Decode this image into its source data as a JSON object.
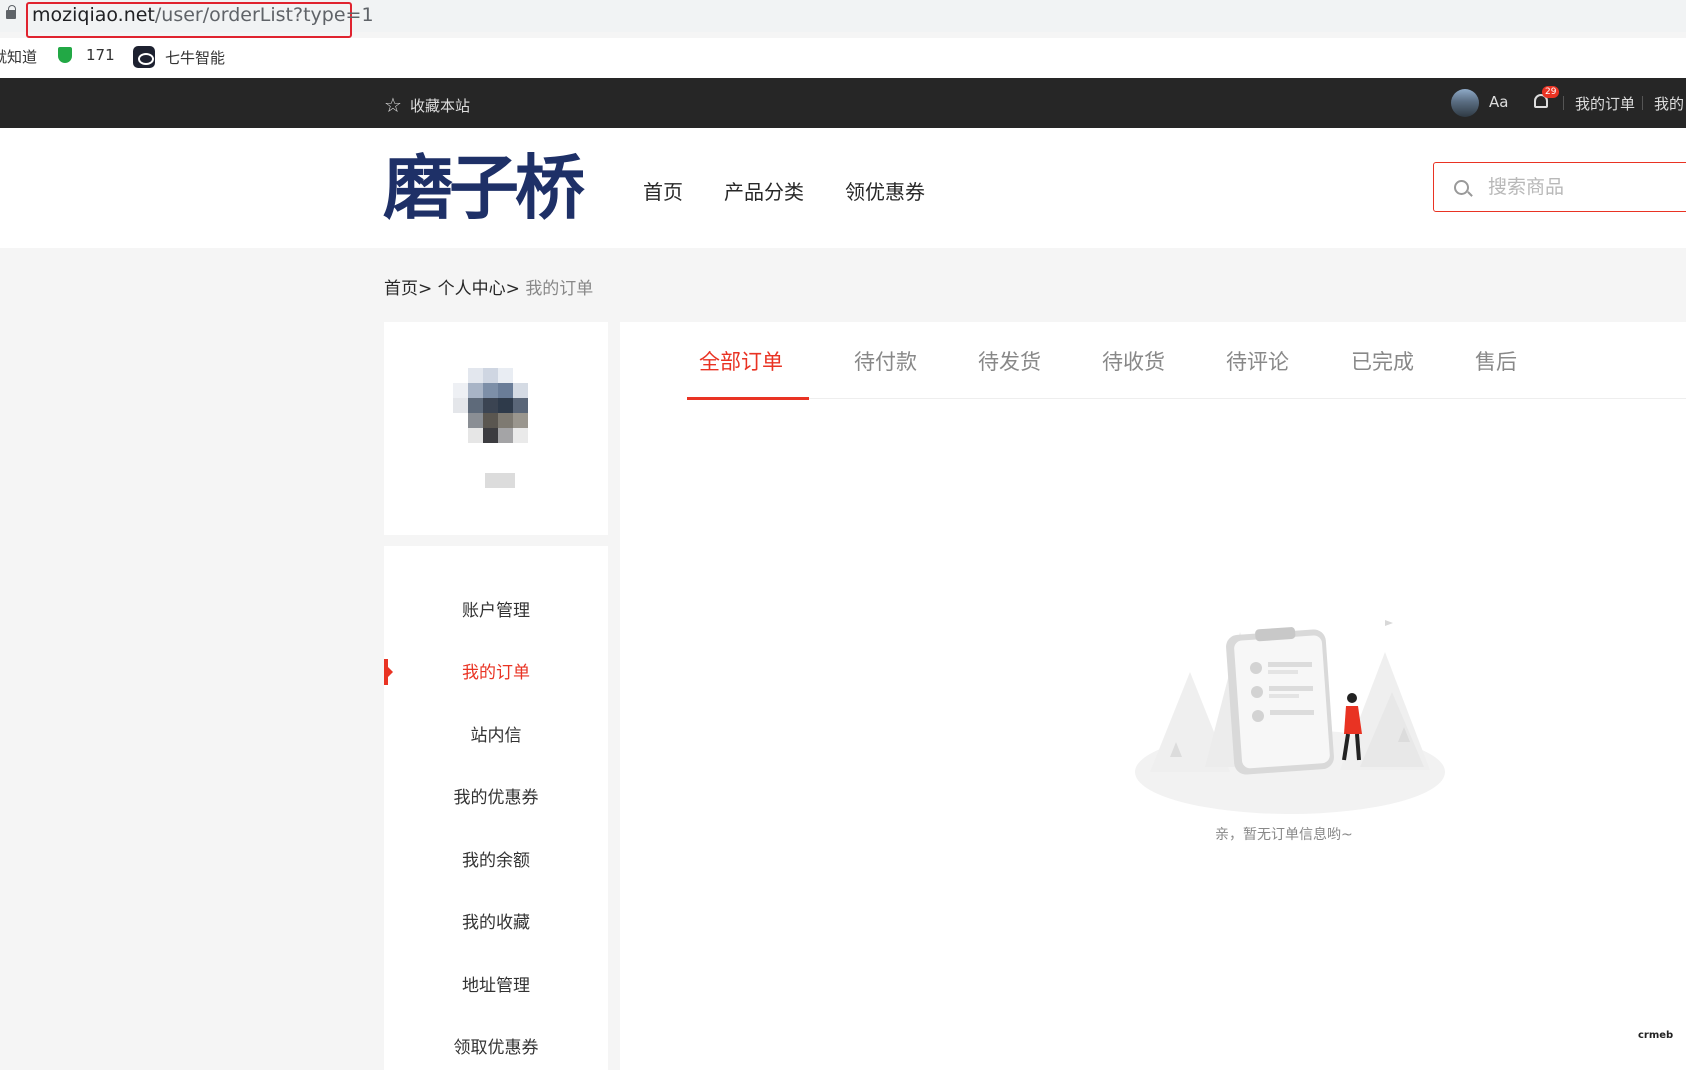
{
  "browser": {
    "url_host": "moziqiao.net",
    "url_path": "/user/orderList?type=1",
    "bookmarks": [
      {
        "label": "就知道",
        "icon": "none"
      },
      {
        "label": "171",
        "icon": "shield-icon"
      },
      {
        "label": "七牛智能",
        "icon": "eye-icon"
      }
    ]
  },
  "topbar": {
    "favorite": "收藏本站",
    "font_toggle": "Aa",
    "notification_count": "29",
    "my_orders": "我的订单",
    "my_more": "我的"
  },
  "header": {
    "logo_text": "磨子桥",
    "nav": [
      "首页",
      "产品分类",
      "领优惠券"
    ],
    "search_placeholder": "搜索商品"
  },
  "breadcrumb": {
    "home": "首页>",
    "center": "个人中心>",
    "current": "我的订单"
  },
  "sidebar": {
    "items": [
      "账户管理",
      "我的订单",
      "站内信",
      "我的优惠券",
      "我的余额",
      "我的收藏",
      "地址管理",
      "领取优惠券"
    ],
    "active_index": 1
  },
  "tabs": [
    "全部订单",
    "待付款",
    "待发货",
    "待收货",
    "待评论",
    "已完成",
    "售后"
  ],
  "empty_text": "亲，暂无订单信息哟~",
  "colors": {
    "accent": "#e93323",
    "topbar": "#262626",
    "logo": "#1e3067"
  }
}
